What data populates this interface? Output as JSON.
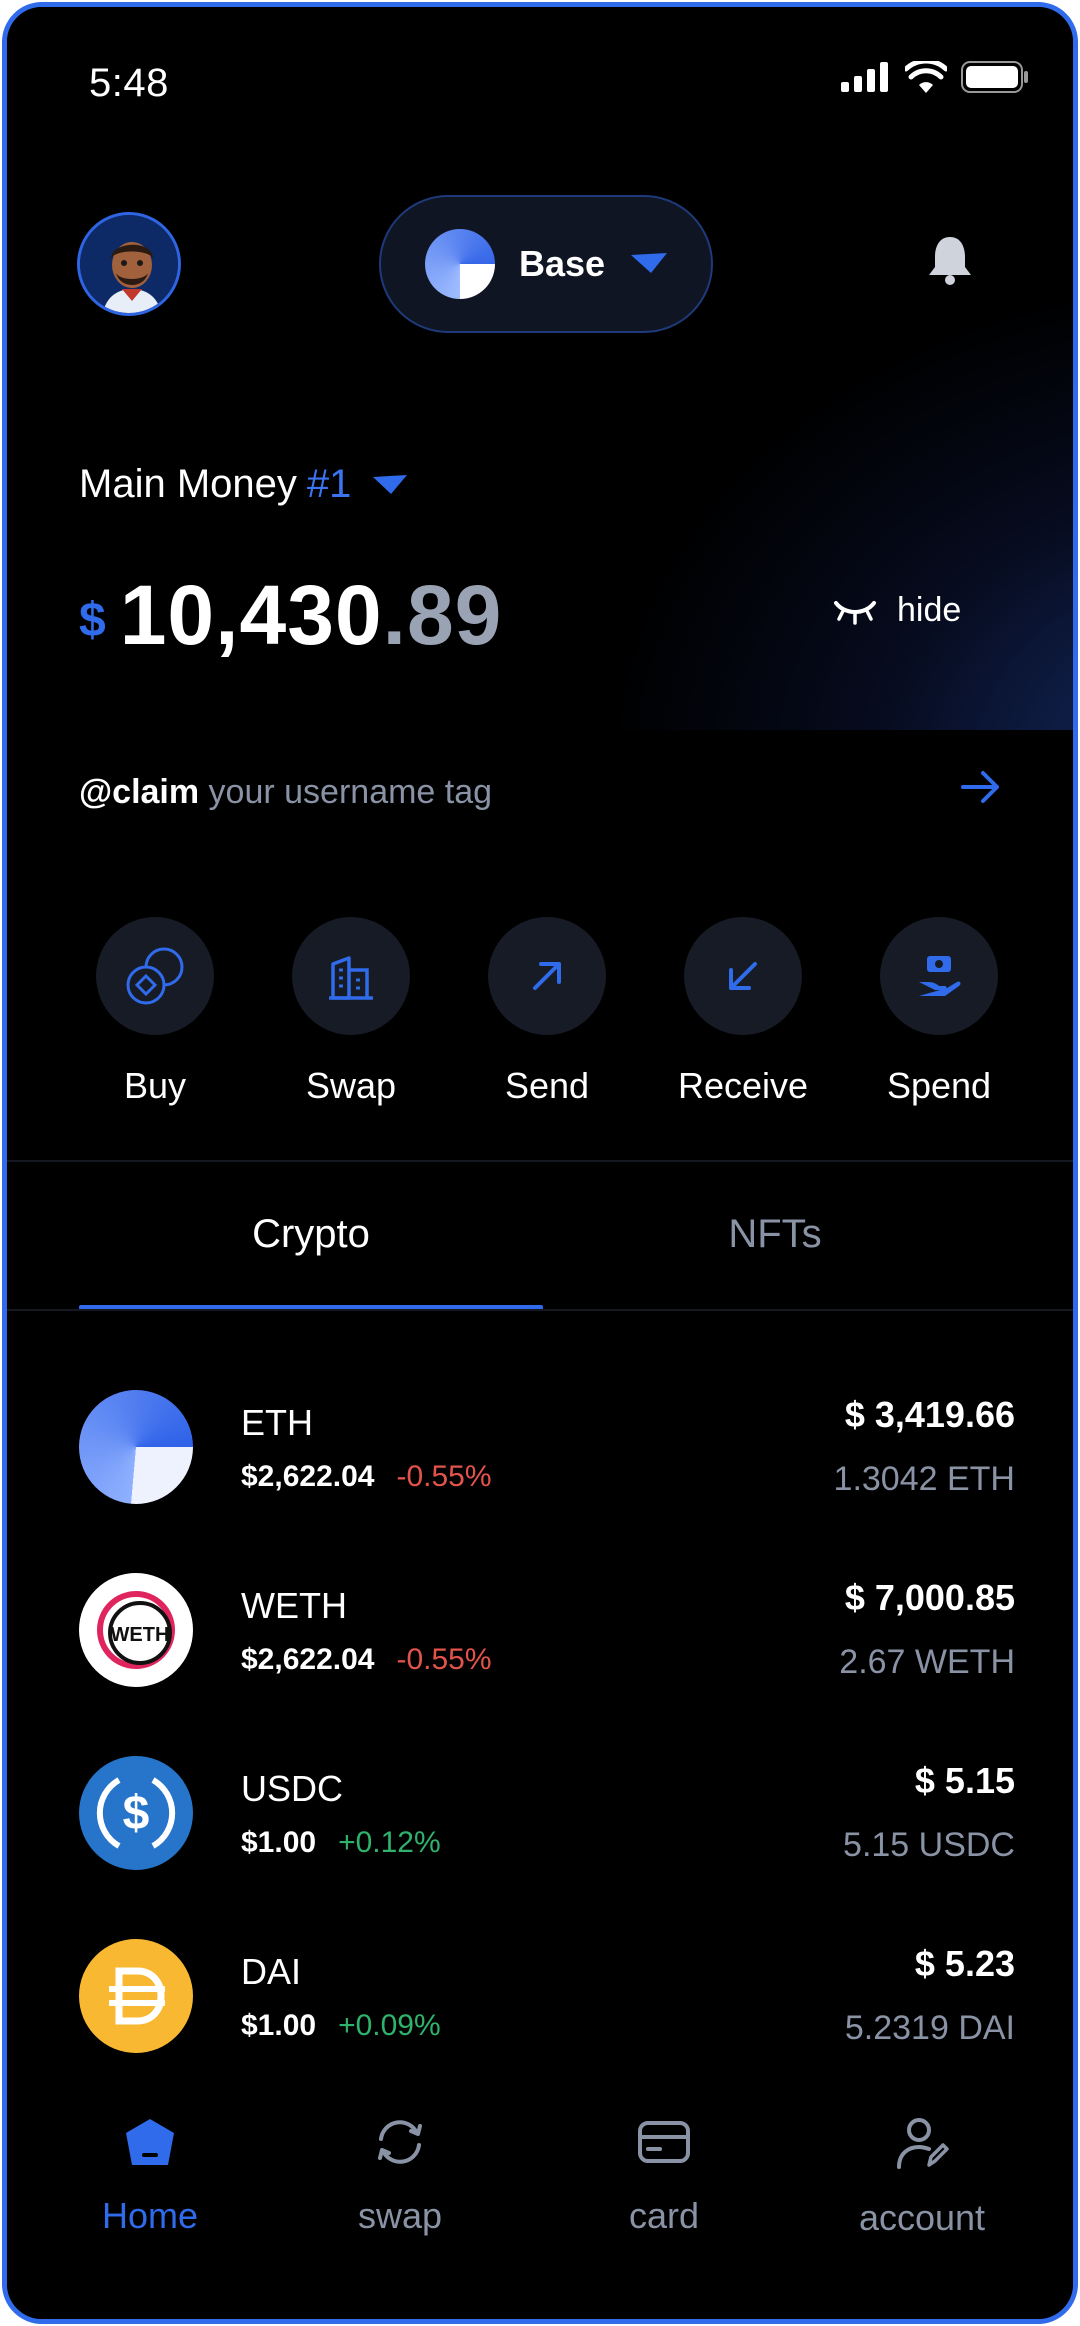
{
  "status_bar": {
    "time": "5:48"
  },
  "header": {
    "network_label": "Base"
  },
  "account": {
    "name": "Main Money",
    "number": "#1",
    "currency_symbol": "$",
    "balance_int": "10,430",
    "balance_dec": ".89",
    "hide_label": "hide"
  },
  "claim": {
    "handle": "@claim",
    "text": " your username tag"
  },
  "actions": [
    {
      "label": "Buy",
      "icon": "buy-icon"
    },
    {
      "label": "Swap",
      "icon": "swap-building-icon"
    },
    {
      "label": "Send",
      "icon": "arrow-up-right-icon"
    },
    {
      "label": "Receive",
      "icon": "arrow-down-left-icon"
    },
    {
      "label": "Spend",
      "icon": "spend-hand-icon"
    }
  ],
  "tabs": {
    "crypto": "Crypto",
    "nfts": "NFTs",
    "active": "Crypto"
  },
  "tokens": [
    {
      "symbol": "ETH",
      "price": "$2,622.04",
      "change": "-0.55%",
      "value": "$ 3,419.66",
      "amount": "1.3042 ETH",
      "icon": "eth-icon"
    },
    {
      "symbol": "WETH",
      "price": "$2,622.04",
      "change": "-0.55%",
      "value": "$ 7,000.85",
      "amount": "2.67 WETH",
      "icon": "weth-icon",
      "icon_text": "WETH"
    },
    {
      "symbol": "USDC",
      "price": "$1.00",
      "change": "+0.12%",
      "value": "$ 5.15",
      "amount": "5.15 USDC",
      "icon": "usdc-icon"
    },
    {
      "symbol": "DAI",
      "price": "$1.00",
      "change": "+0.09%",
      "value": "$ 5.23",
      "amount": "5.2319 DAI",
      "icon": "dai-icon"
    }
  ],
  "bottom_nav": [
    {
      "label": "Home",
      "icon": "home-icon",
      "active": true
    },
    {
      "label": "swap",
      "icon": "swap-icon",
      "active": false
    },
    {
      "label": "card",
      "icon": "card-icon",
      "active": false
    },
    {
      "label": "account",
      "icon": "account-icon",
      "active": false
    }
  ],
  "colors": {
    "accent": "#2f6bea",
    "negative": "#e2534b",
    "positive": "#2fb36c",
    "muted": "#8a93a5"
  }
}
